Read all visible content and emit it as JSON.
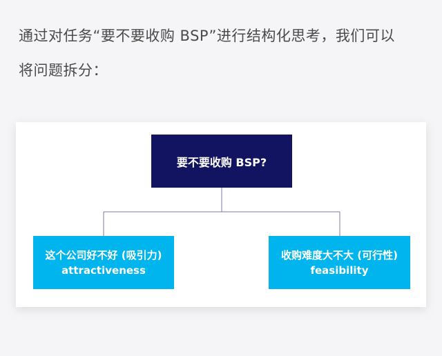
{
  "intro": {
    "line1": "通过对任务“要不要收购 BSP”进行结构化思考，我们可以",
    "line2": "将问题拆分："
  },
  "diagram": {
    "root": {
      "label": "要不要收购 BSP?"
    },
    "children": [
      {
        "label_cn": "这个公司好不好 (吸引力)",
        "label_en": "attractiveness"
      },
      {
        "label_cn": "收购难度大不大 (可行性)",
        "label_en": "feasibility"
      }
    ]
  },
  "colors": {
    "page_background": "#f5f5f7",
    "card_background": "#ffffff",
    "root_box": "#121462",
    "child_box": "#00b4ee",
    "connector": "#7878a8",
    "intro_text": "#4a4a4a"
  }
}
